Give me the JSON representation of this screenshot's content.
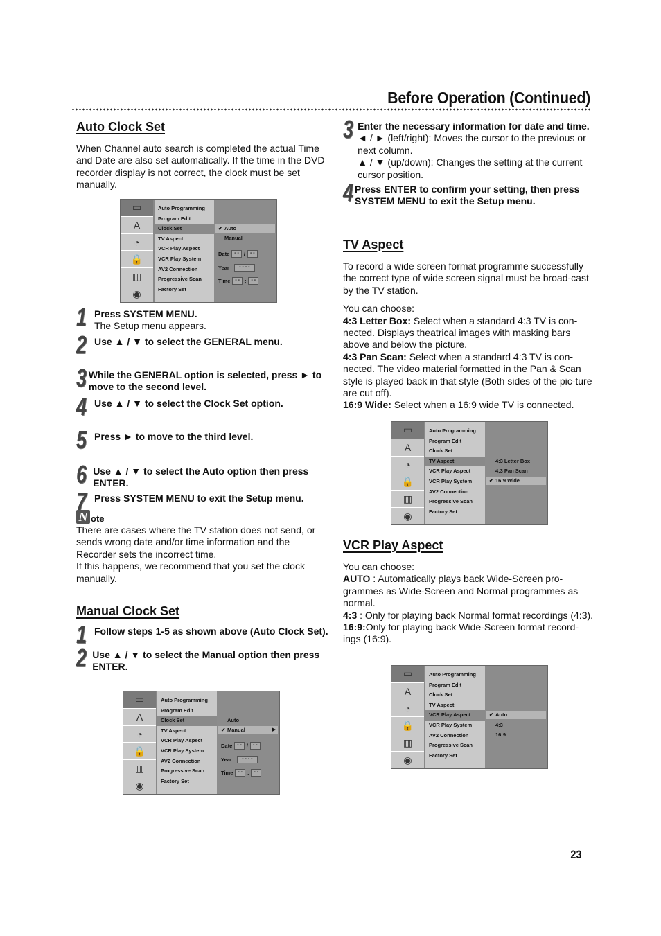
{
  "page": {
    "title": "Before Operation (Continued)",
    "page_number": "23"
  },
  "auto_clock": {
    "heading": "Auto Clock Set",
    "intro": "When Channel auto search is completed the actual Time and Date are also set automatically. If the time in the DVD recorder display is not correct, the clock must be set manually.",
    "steps": [
      {
        "num": "1",
        "text": "Press SYSTEM MENU.",
        "sub": "The Setup menu appears."
      },
      {
        "num": "2",
        "text": "Use ▲ / ▼ to select the GENERAL menu.",
        "sub": ""
      },
      {
        "num": "3",
        "text": "While the GENERAL option is selected, press ► to move to the second level.",
        "sub": ""
      },
      {
        "num": "4",
        "text": "Use ▲ / ▼ to select the Clock Set option.",
        "sub": ""
      },
      {
        "num": "5",
        "text": "Press ► to move to the third level.",
        "sub": ""
      },
      {
        "num": "6",
        "text": "Use ▲ / ▼ to select the Auto option then press ENTER.",
        "sub": ""
      },
      {
        "num": "7",
        "text": "Press SYSTEM MENU to exit the Setup menu.",
        "sub": ""
      }
    ]
  },
  "note": {
    "icon_letter": "N",
    "label": "ote",
    "lines": [
      "There are cases where the TV station does not send, or sends wrong date and/or time information and the Recorder sets the incorrect time.",
      "If this happens, we recommend that you set the clock manually."
    ]
  },
  "manual_clock": {
    "heading": "Manual Clock Set",
    "steps": [
      {
        "num": "1",
        "text": "Follow steps 1-5 as shown above (Auto Clock Set)."
      },
      {
        "num": "2",
        "text": "Use ▲ / ▼ to select the Manual option then press ENTER."
      }
    ],
    "steps_cont": [
      {
        "num": "3",
        "text": "Enter the necessary information for date and time.",
        "lines": [
          "◄ / ► (left/right): Moves the cursor to the previous or next column.",
          "▲ / ▼ (up/down): Changes the setting at the current cursor position."
        ]
      },
      {
        "num": "4",
        "text": "Press ENTER to confirm your setting, then press SYSTEM MENU to exit the Setup menu.",
        "lines": []
      }
    ]
  },
  "tv_aspect": {
    "heading": "TV Aspect",
    "intro": "To record a wide screen format programme successfully the correct type of wide screen signal must be broad-cast by the TV station.",
    "choose": "You can choose:",
    "options": [
      {
        "label": "4:3 Letter Box:",
        "desc": " Select when a standard 4:3 TV is con-nected. Displays theatrical images with masking bars above and below the picture."
      },
      {
        "label": "4:3 Pan Scan:",
        "desc": " Select when a standard 4:3 TV is con-nected. The video material formatted in the Pan & Scan style is played back in that style (Both sides of the pic-ture are cut off)."
      },
      {
        "label": "16:9 Wide:",
        "desc": " Select when a 16:9 wide TV is connected."
      }
    ]
  },
  "vcr_aspect": {
    "heading": "VCR Play Aspect",
    "choose": "You can choose:",
    "options": [
      {
        "label": "AUTO",
        "desc": " : Automatically plays back Wide-Screen pro-grammes as Wide-Screen and Normal programmes as normal."
      },
      {
        "label": "4:3",
        "desc": " : Only for playing back Normal format recordings (4:3)."
      },
      {
        "label": "16:9:",
        "desc": "Only for playing back Wide-Screen format record-ings (16:9)."
      }
    ]
  },
  "menu_common": {
    "icons": [
      "tv-icon",
      "language-icon",
      "audio-disc-icon",
      "lock-icon",
      "film-icon",
      "disc-icon"
    ],
    "icon_glyphs": [
      "▭",
      "A",
      "◔",
      "🔒",
      "▥",
      "◉"
    ],
    "items": [
      "Auto Programming",
      "Program Edit",
      "Clock Set",
      "TV Aspect",
      "VCR Play Aspect",
      "VCR Play System",
      "AV2 Connection",
      "Progressive Scan",
      "Factory Set"
    ]
  },
  "menus": {
    "auto_clock": {
      "selected_item": "Clock Set",
      "options": [
        "Auto",
        "Manual"
      ],
      "checked": "Auto",
      "date_label": "Date",
      "date_val1": "- -",
      "date_sep": "/",
      "date_val2": "- -",
      "year_label": "Year",
      "year_val": "- - - -",
      "time_label": "Time",
      "time_val1": "- -",
      "time_sep": ":",
      "time_val2": "- -"
    },
    "manual_clock": {
      "selected_item": "Clock Set",
      "options": [
        "Auto",
        "Manual"
      ],
      "checked": "Manual",
      "date_label": "Date",
      "date_val1": "- -",
      "date_sep": "/",
      "date_val2": "- -",
      "year_label": "Year",
      "year_val": "- - - -",
      "time_label": "Time",
      "time_val1": "- -",
      "time_sep": ":",
      "time_val2": "- -"
    },
    "tv_aspect": {
      "selected_item": "TV Aspect",
      "options": [
        "4:3 Letter Box",
        "4:3 Pan Scan",
        "16:9 Wide"
      ],
      "checked": "16:9 Wide"
    },
    "vcr_aspect": {
      "selected_item": "VCR Play Aspect",
      "options": [
        "Auto",
        "4:3",
        "16:9"
      ],
      "checked": "Auto"
    }
  }
}
